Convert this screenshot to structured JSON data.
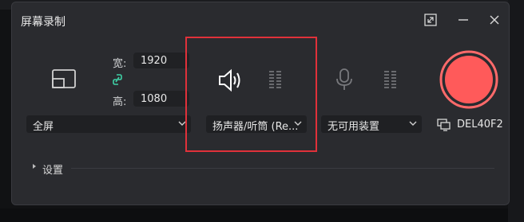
{
  "window": {
    "title": "屏幕录制"
  },
  "capture": {
    "width_label": "宽:",
    "width_value": "1920",
    "height_label": "高:",
    "height_value": "1080",
    "mode_value": "全屏"
  },
  "audio": {
    "speaker_device": "扬声器/听筒 (Re...",
    "mic_device": "无可用装置"
  },
  "display": {
    "label": "DEL40F2"
  },
  "settings": {
    "label": "设置"
  },
  "colors": {
    "record": "#ff5a5a",
    "record_ring": "#ff6a6a",
    "highlight": "#e0313a",
    "window_bg": "#2a2b2f",
    "field_bg": "#202124",
    "link_icon": "#3fd0a5"
  }
}
